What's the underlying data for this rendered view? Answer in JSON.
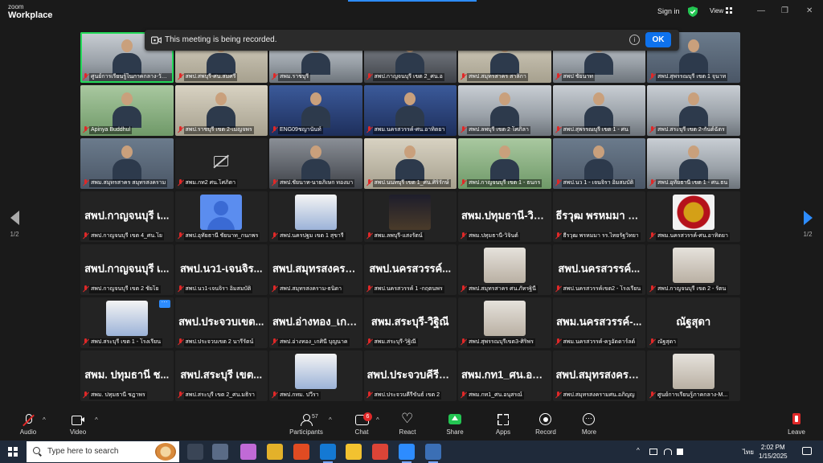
{
  "titlebar": {
    "logo_top": "zoom",
    "logo_bottom": "Workplace",
    "signin": "Sign in",
    "view": "View",
    "minimize": "—",
    "restore": "❐",
    "close": "✕"
  },
  "banner": {
    "message": "This meeting is being recorded.",
    "info": "i",
    "ok": "OK"
  },
  "gallery": {
    "page_left": "1/2",
    "page_right": "1/2",
    "tiles": [
      {
        "name": "ศูนย์การเรียนรู้ในภาคกลาง-วัชรพิฐ",
        "kind": "video",
        "variant": "v2",
        "active": true
      },
      {
        "name": "สพป.สพบุรี-ศน.สมศรี",
        "kind": "video",
        "variant": "v6"
      },
      {
        "name": "สพม.ราชบุรี",
        "kind": "video",
        "variant": "v2"
      },
      {
        "name": "สพป.กาญจนบุรี เขต 2_ศน.อ",
        "kind": "video",
        "variant": "video"
      },
      {
        "name": "สพป.สมุทรสาคร สาลิกา",
        "kind": "video",
        "variant": "v6"
      },
      {
        "name": "สพป ชัยนาท",
        "kind": "video",
        "variant": "v2"
      },
      {
        "name": "สพป.สุพรรณบุรี เขต 1 จุนาท",
        "kind": "video",
        "variant": "v3"
      },
      {
        "name": "Apinya Buddhul",
        "kind": "video",
        "variant": "v5"
      },
      {
        "name": "สพป.ราชบุรี เขต 2-เมญจพร",
        "kind": "video",
        "variant": "v6"
      },
      {
        "name": "ENG09ชญานันท์",
        "kind": "video",
        "variant": "v4"
      },
      {
        "name": "สพม.นครสวรรค์-ศน.อาทิตยา",
        "kind": "video",
        "variant": "v4"
      },
      {
        "name": "สพป.ลพบุรี เขต 2 โศภิลา",
        "kind": "video",
        "variant": "v2"
      },
      {
        "name": "สพป.สุพรรณบุรี เขต 1 - ศน",
        "kind": "video",
        "variant": "v2"
      },
      {
        "name": "สพป.สระบุรี เขต 2-กันต์ฉัตร",
        "kind": "video",
        "variant": "v2"
      },
      {
        "name": "สพม.สมุทรสาคร สมุทรสงคราม",
        "kind": "video",
        "variant": "v3"
      },
      {
        "name": "สพม.กท2 ศน.โศภิตา",
        "kind": "camoff"
      },
      {
        "name": "สพป.ชัยนาท-นายภิเษก ทองมา",
        "kind": "video",
        "variant": "video"
      },
      {
        "name": "สพป.นนทบุรี เขต 1_ศน.ศิริรักษ์",
        "kind": "video",
        "variant": "v6"
      },
      {
        "name": "สพป.กาญจนบุรี เขต 1 - ธนกร",
        "kind": "video",
        "variant": "v5"
      },
      {
        "name": "สพป.นว 1 - เจนจิรา อิ่มสมบัติ",
        "kind": "video",
        "variant": "v3"
      },
      {
        "name": "สพป.อุทัยธานี เขต 1 - ศน.ธน",
        "kind": "video",
        "variant": "v2"
      },
      {
        "display": "สพป.กาญจนบุรี เ...",
        "name": "สพป.กาญจนบุรี เขต 4_ศน.โย",
        "kind": "text"
      },
      {
        "name": "สพป.อุทัยธานี ชัยนาท_กนกพร",
        "kind": "avatar",
        "avatar": "av-default"
      },
      {
        "name": "สพป.นครปฐม เขต 1 สุขารี",
        "kind": "avatar",
        "avatar": "av-photo3"
      },
      {
        "name": "สพม.ลพบุรี-แสงรัตน์",
        "kind": "avatar",
        "avatar": "av-photo2"
      },
      {
        "display": "สพม.ปทุมธานี-วิจิ...",
        "name": "สพม.ปทุมธานี-วิจินต์",
        "kind": "text"
      },
      {
        "display": "ธีรวุฒ พรหมมา ร...",
        "name": "ธีรวุฒ พรหมมา รร.ไทยรัฐวิทยา",
        "kind": "text"
      },
      {
        "name": "สพม.นครสวรรค์-ศน.อาทิตยา",
        "kind": "avatar",
        "avatar": "av-seal"
      },
      {
        "display": "สพป.กาญจนบุรี เ...",
        "name": "สพป.กาญจนบุรี เขต 2 ชัยโย",
        "kind": "text"
      },
      {
        "display": "สพป.นว1-เจนจิร...",
        "name": "สพป.นว1-เจนจิรา อิ่มสมบัติ",
        "kind": "text"
      },
      {
        "display": "สพป.สมุทรสงครา...",
        "name": "สพป.สมุทรสงคราม-ธนิดา",
        "kind": "text"
      },
      {
        "display": "สพป.นครสวรรค์...",
        "name": "สพป.นครสวรรค์ 1 -กฤตนพร",
        "kind": "text"
      },
      {
        "name": "สพป.สมุทรสาคร ศน.ภัทรฐินี",
        "kind": "avatar",
        "avatar": "av-photo"
      },
      {
        "display": "สพป.นครสวรรค์...",
        "name": "สพป.นครสวรรค์เขต2 - โรงเรียน",
        "kind": "text"
      },
      {
        "name": "สพป.กาญจนบุรี เขต 2 - รัตน",
        "kind": "avatar",
        "avatar": "av-photo"
      },
      {
        "name": "สพป.สระบุรี เขต 1 - โรงเรียน",
        "kind": "avatar",
        "avatar": "av-photo3",
        "more": true
      },
      {
        "display": "สพป.ประจวบเขต...",
        "name": "สพป.ประจวบเขต 2 นารีรัตน์",
        "kind": "text"
      },
      {
        "display": "สพป.อ่างทอง_เกศิ...",
        "name": "สพป.อ่างทอง_เกศินี บุญนาค",
        "kind": "text"
      },
      {
        "display": "สพม.สระบุรี-วิฐิณี",
        "name": "สพม.สระบุรี-วิฐิณี",
        "kind": "text"
      },
      {
        "name": "สพป.สุพรรณบุรีเขต3-ศิริพร",
        "kind": "avatar",
        "avatar": "av-photo"
      },
      {
        "display": "สพม.นครสวรรค์-...",
        "name": "สพม.นครสวรรค์-ครูอัดดาร์ลด์",
        "kind": "text"
      },
      {
        "display": "ณัฐสุดา",
        "name": "ณัฐสุดา",
        "kind": "text"
      },
      {
        "display": "สพม. ปทุมธานี ช...",
        "name": "สพม. ปทุมธานี ชฎาพร",
        "kind": "text"
      },
      {
        "display": "สพป.สระบุรี เขต...",
        "name": "สพป.สระบุรี เขต 2_ศน.มธิรา",
        "kind": "text"
      },
      {
        "name": "สพป.กทม. ปวีรา",
        "kind": "avatar",
        "avatar": "av-photo3"
      },
      {
        "display": "สพป.ประจวบคีรีขั...",
        "name": "สพป.ประจวบคีรีขันธ์ เขต 2",
        "kind": "text"
      },
      {
        "display": "สพม.กท1_ศน.อนุ...",
        "name": "สพม.กท1_ศน.อนุสรณ์",
        "kind": "text"
      },
      {
        "display": "สพป.สมุทรสงครา...",
        "name": "สพป.สมุทรสงครามศน.อภิญญ",
        "kind": "text"
      },
      {
        "name": "ศูนย์การเรียนรู้ภาคกลาง-M...",
        "kind": "avatar",
        "avatar": "av-photo"
      }
    ]
  },
  "toolbar": {
    "audio": "Audio",
    "video": "Video",
    "participants": "Participants",
    "participants_count": "57",
    "chat": "Chat",
    "chat_badge": "6",
    "react": "React",
    "share": "Share",
    "apps": "Apps",
    "record": "Record",
    "more": "More",
    "leave": "Leave",
    "caret": "^"
  },
  "taskbar": {
    "search_placeholder": "Type here to search",
    "lang": "ไทย",
    "time": "2:02 PM",
    "date": "1/15/2025"
  }
}
